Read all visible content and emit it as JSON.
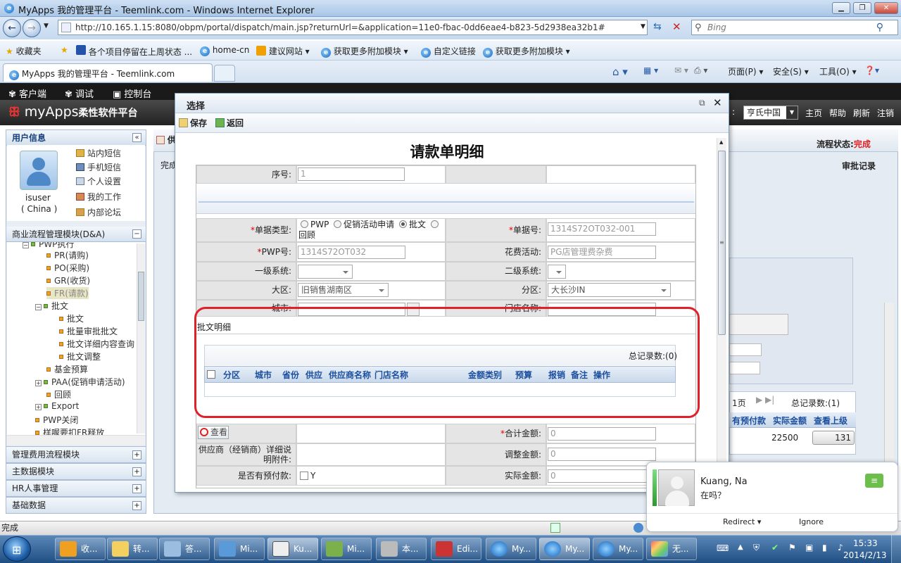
{
  "window": {
    "title": "MyApps 我的管理平台 - Teemlink.com - Windows Internet Explorer",
    "url": "http://10.165.1.15:8080/obpm/portal/dispatch/main.jsp?returnUrl=&application=11e0-fbac-0dd6eae4-b823-5d2938ea32b1#",
    "search_placeholder": "Bing",
    "tab_title": "MyApps 我的管理平台 - Teemlink.com",
    "status_text": "完成"
  },
  "favorites": [
    "收藏夹",
    "各个项目停留在上周状态 ...",
    "home-cn",
    "建议网站 ▾",
    "获取更多附加模块 ▾",
    "自定义链接",
    "获取更多附加模块 ▾"
  ],
  "ie_commands": [
    "页面(P) ▾",
    "安全(S) ▾",
    "工具(O) ▾"
  ],
  "app": {
    "menu": [
      "客户端",
      "调试",
      "控制台"
    ],
    "logo_main": "myApps",
    "logo_sub": "柔性软件平台",
    "company": "亨氏中国",
    "header_links": [
      "主页",
      "帮助",
      "刷新",
      "注销"
    ]
  },
  "left_panel": {
    "user_header": "用户信息",
    "user_name": "isuser",
    "user_org": "( China )",
    "user_links": [
      "站内短信",
      "手机短信",
      "个人设置",
      "我的工作",
      "内部论坛"
    ],
    "module_header": "商业流程管理模块(D&A)",
    "tree": [
      {
        "label": "PWP执行",
        "level": 1
      },
      {
        "label": "PR(请购)",
        "level": 2
      },
      {
        "label": "PO(采购)",
        "level": 2
      },
      {
        "label": "GR(收货)",
        "level": 2
      },
      {
        "label": "FR(请款)",
        "level": 2
      },
      {
        "label": "批文",
        "level": 1
      },
      {
        "label": "批文",
        "level": 2
      },
      {
        "label": "批量审批批文",
        "level": 2
      },
      {
        "label": "批文详细内容查询",
        "level": 2
      },
      {
        "label": "批文调整",
        "level": 2
      },
      {
        "label": "基金预算",
        "level": 1
      },
      {
        "label": "PAA(促销申请活动)",
        "level": 1
      },
      {
        "label": "回顾",
        "level": 1
      },
      {
        "label": "Export",
        "level": 1
      },
      {
        "label": "PWP关闭",
        "level": 0
      },
      {
        "label": "样喔要扣FR释放",
        "level": 0
      }
    ],
    "modules": [
      "管理费用流程模块",
      "主数据模块",
      "HR人事管理",
      "基础数据"
    ]
  },
  "background": {
    "tab_label": "供",
    "done_label": "完成",
    "flow_status_label": "流程状态:",
    "flow_status_value": "完成",
    "approval_record": "审批记录",
    "pager_page": "1页",
    "pager_total": "总记录数:(1)",
    "col_prepay": "有预付款",
    "col_actual": "实际金额",
    "col_view": "查看上级",
    "cell_amount": "22500",
    "cell_btn": "131"
  },
  "dialog": {
    "title": "选择",
    "toolbar": {
      "save": "保存",
      "back": "返回"
    },
    "form_title": "请款单明细",
    "fields": {
      "seq_label": "序号:",
      "seq_value": "1",
      "doc_type_label": "单据类型:",
      "doc_type_options": [
        "PWP",
        "促销活动申请",
        "批文",
        "回顾"
      ],
      "doc_type_selected": "批文",
      "doc_no_label": "单据号:",
      "doc_no_value": "1314S72OT032-001",
      "pwp_label": "PWP号:",
      "pwp_value": "1314S72OT032",
      "activity_label": "花费活动:",
      "activity_value": "PG店管理费杂费",
      "sys1_label": "一级系统:",
      "sys2_label": "二级系统:",
      "region_label": "大区:",
      "region_value": "旧销售湖南区",
      "district_label": "分区:",
      "district_value": "大长沙IN",
      "city_label": "城市:",
      "store_label": "门店名称:"
    },
    "detail": {
      "title": "批文明细",
      "total": "总记录数:(0)",
      "columns": [
        "分区",
        "城市",
        "省份",
        "供应",
        "供应商名称",
        "门店名称",
        "金额类别",
        "预算",
        "报销",
        "备注",
        "操作"
      ]
    },
    "lower": {
      "view_btn": "查看",
      "total_amount_label": "合计金额:",
      "total_amount_value": "0",
      "attach_label": "供应商（经销商）详细说明附件:",
      "adjust_label": "调整金额:",
      "adjust_value": "0",
      "prepay_label": "是否有预付款:",
      "prepay_option": "Y",
      "actual_label": "实际金额:",
      "actual_value": "0"
    }
  },
  "chat": {
    "name": "Kuang, Na",
    "message": "在吗？",
    "redirect": "Redirect",
    "ignore": "Ignore"
  },
  "taskbar": {
    "items": [
      "收...",
      "转...",
      "答...",
      "Mi...",
      "Ku...",
      "Mi...",
      "本...",
      "Edi...",
      "My...",
      "My...",
      "My...",
      "无..."
    ],
    "time": "15:33",
    "date": "2014/2/13"
  },
  "colors": {
    "accent_red": "#e0202a",
    "header_dark": "#222222",
    "ie_blue": "#1565c0"
  }
}
